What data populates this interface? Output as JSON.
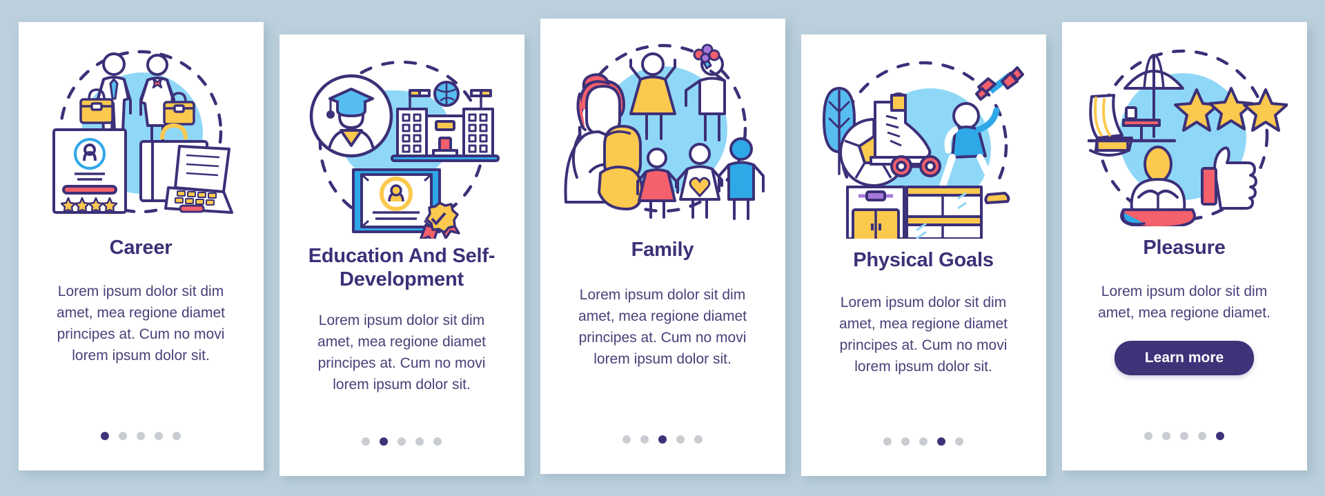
{
  "theme": {
    "background": "#bbd0dc",
    "card_background": "#ffffff",
    "title_color": "#3c3078",
    "text_color": "#484078",
    "accent": "#3f3279",
    "dot_inactive": "#c9cdd2",
    "illustration_blue": "#7ed3f7",
    "illustration_yellow": "#fcc953",
    "illustration_red": "#f4606b",
    "illustration_outline": "#3c3078"
  },
  "cards": [
    {
      "id": "career",
      "title": "Career",
      "body": "Lorem ipsum dolor sit dim amet, mea regione diamet principes at. Cum no movi lorem ipsum dolor sit.",
      "illustration": "career-illustration",
      "illustration_parts": [
        "businessman-figure",
        "businesswoman-figure",
        "briefcase",
        "resume-document",
        "star-rating",
        "laptop"
      ],
      "dots": {
        "count": 5,
        "active_index": 0
      },
      "button": null
    },
    {
      "id": "education-and-self-development",
      "title": "Education And Self-Development",
      "body": "Lorem ipsum dolor sit dim amet, mea regione diamet principes at. Cum no movi lorem ipsum dolor sit.",
      "illustration": "education-illustration",
      "illustration_parts": [
        "graduate-avatar",
        "graduation-cap",
        "school-building",
        "globe",
        "flags",
        "diploma-certificate",
        "award-ribbon"
      ],
      "dots": {
        "count": 5,
        "active_index": 1
      },
      "button": null
    },
    {
      "id": "family",
      "title": "Family",
      "body": "Lorem ipsum dolor sit dim amet, mea regione diamet principes at. Cum no movi lorem ipsum dolor sit.",
      "illustration": "family-illustration",
      "illustration_parts": [
        "mother-with-baby",
        "woman-figure",
        "man-with-flowers",
        "girl-figure",
        "woman-with-heart",
        "man-figure"
      ],
      "dots": {
        "count": 5,
        "active_index": 2
      },
      "button": null
    },
    {
      "id": "physical-goals",
      "title": "Physical Goals",
      "body": "Lorem ipsum dolor sit dim amet, mea regione diamet principes at. Cum no movi lorem ipsum dolor sit.",
      "illustration": "physical-goals-illustration",
      "illustration_parts": [
        "tree",
        "soccer-ball",
        "roller-skate",
        "athlete-with-dumbbell",
        "gym-locker",
        "dumbbell-icon"
      ],
      "dots": {
        "count": 5,
        "active_index": 3
      },
      "button": null
    },
    {
      "id": "pleasure",
      "title": "Pleasure",
      "body": "Lorem ipsum dolor sit dim amet, mea regione diamet.",
      "illustration": "pleasure-illustration",
      "illustration_parts": [
        "beach-umbrella",
        "rocking-chair",
        "side-table",
        "three-stars",
        "meditating-person",
        "thumbs-up-hand",
        "surfboard"
      ],
      "dots": {
        "count": 5,
        "active_index": 4
      },
      "button": {
        "label": "Learn more"
      }
    }
  ]
}
